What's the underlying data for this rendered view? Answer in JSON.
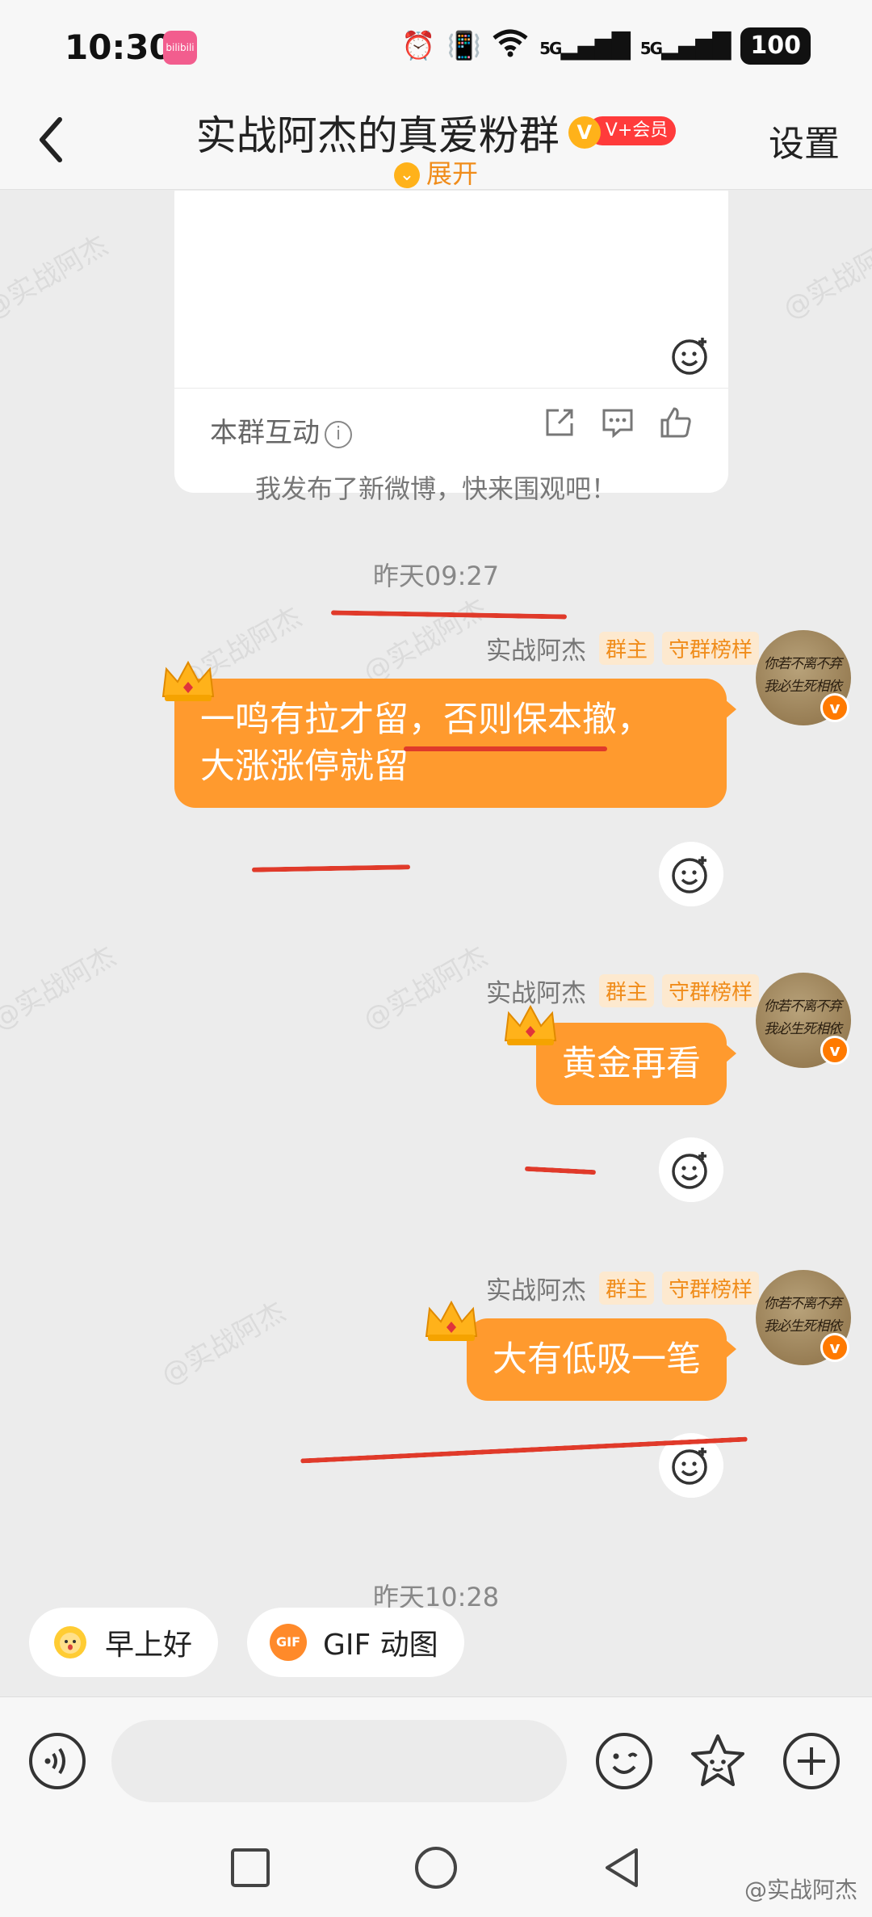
{
  "status_bar": {
    "time": "10:30",
    "app_badge": "bilibili",
    "network_1": "5G",
    "network_2": "5G",
    "battery": "100"
  },
  "header": {
    "title": "实战阿杰的真爱粉群",
    "vip_label": "V+会员",
    "vip_letter": "V",
    "expand_label": "展开",
    "settings_label": "设置"
  },
  "card": {
    "footer_label": "本群互动",
    "info_glyph": "i"
  },
  "watermark_text": "@实战阿杰",
  "system_message": "我发布了新微博，快来围观吧！",
  "timestamps": {
    "first": "昨天09:27",
    "second": "昨天10:28"
  },
  "sender": {
    "name": "实战阿杰",
    "tag_owner": "群主",
    "tag_rank": "守群榜样",
    "avatar_badge": "v",
    "avatar_text_line1": "你若不离不弃",
    "avatar_text_line2": "我必生死相依"
  },
  "messages": [
    {
      "text_line1": "一鸣有拉才留，否则保本撤，",
      "text_line2": "大涨涨停就留"
    },
    {
      "text_line1": "黄金再看"
    },
    {
      "text_line1": "大有低吸一笔"
    }
  ],
  "quick_replies": [
    {
      "label": "早上好",
      "icon": "sun-face-icon"
    },
    {
      "label": "GIF 动图",
      "icon_text": "GIF",
      "icon": "gif-icon"
    }
  ],
  "input": {
    "placeholder": ""
  },
  "footer_watermark": "@实战阿杰",
  "colors": {
    "bubble": "#ff9a2e",
    "accent": "#f08c1a",
    "annotation_red": "#e03a2a",
    "vip_red": "#ff3b3b"
  }
}
